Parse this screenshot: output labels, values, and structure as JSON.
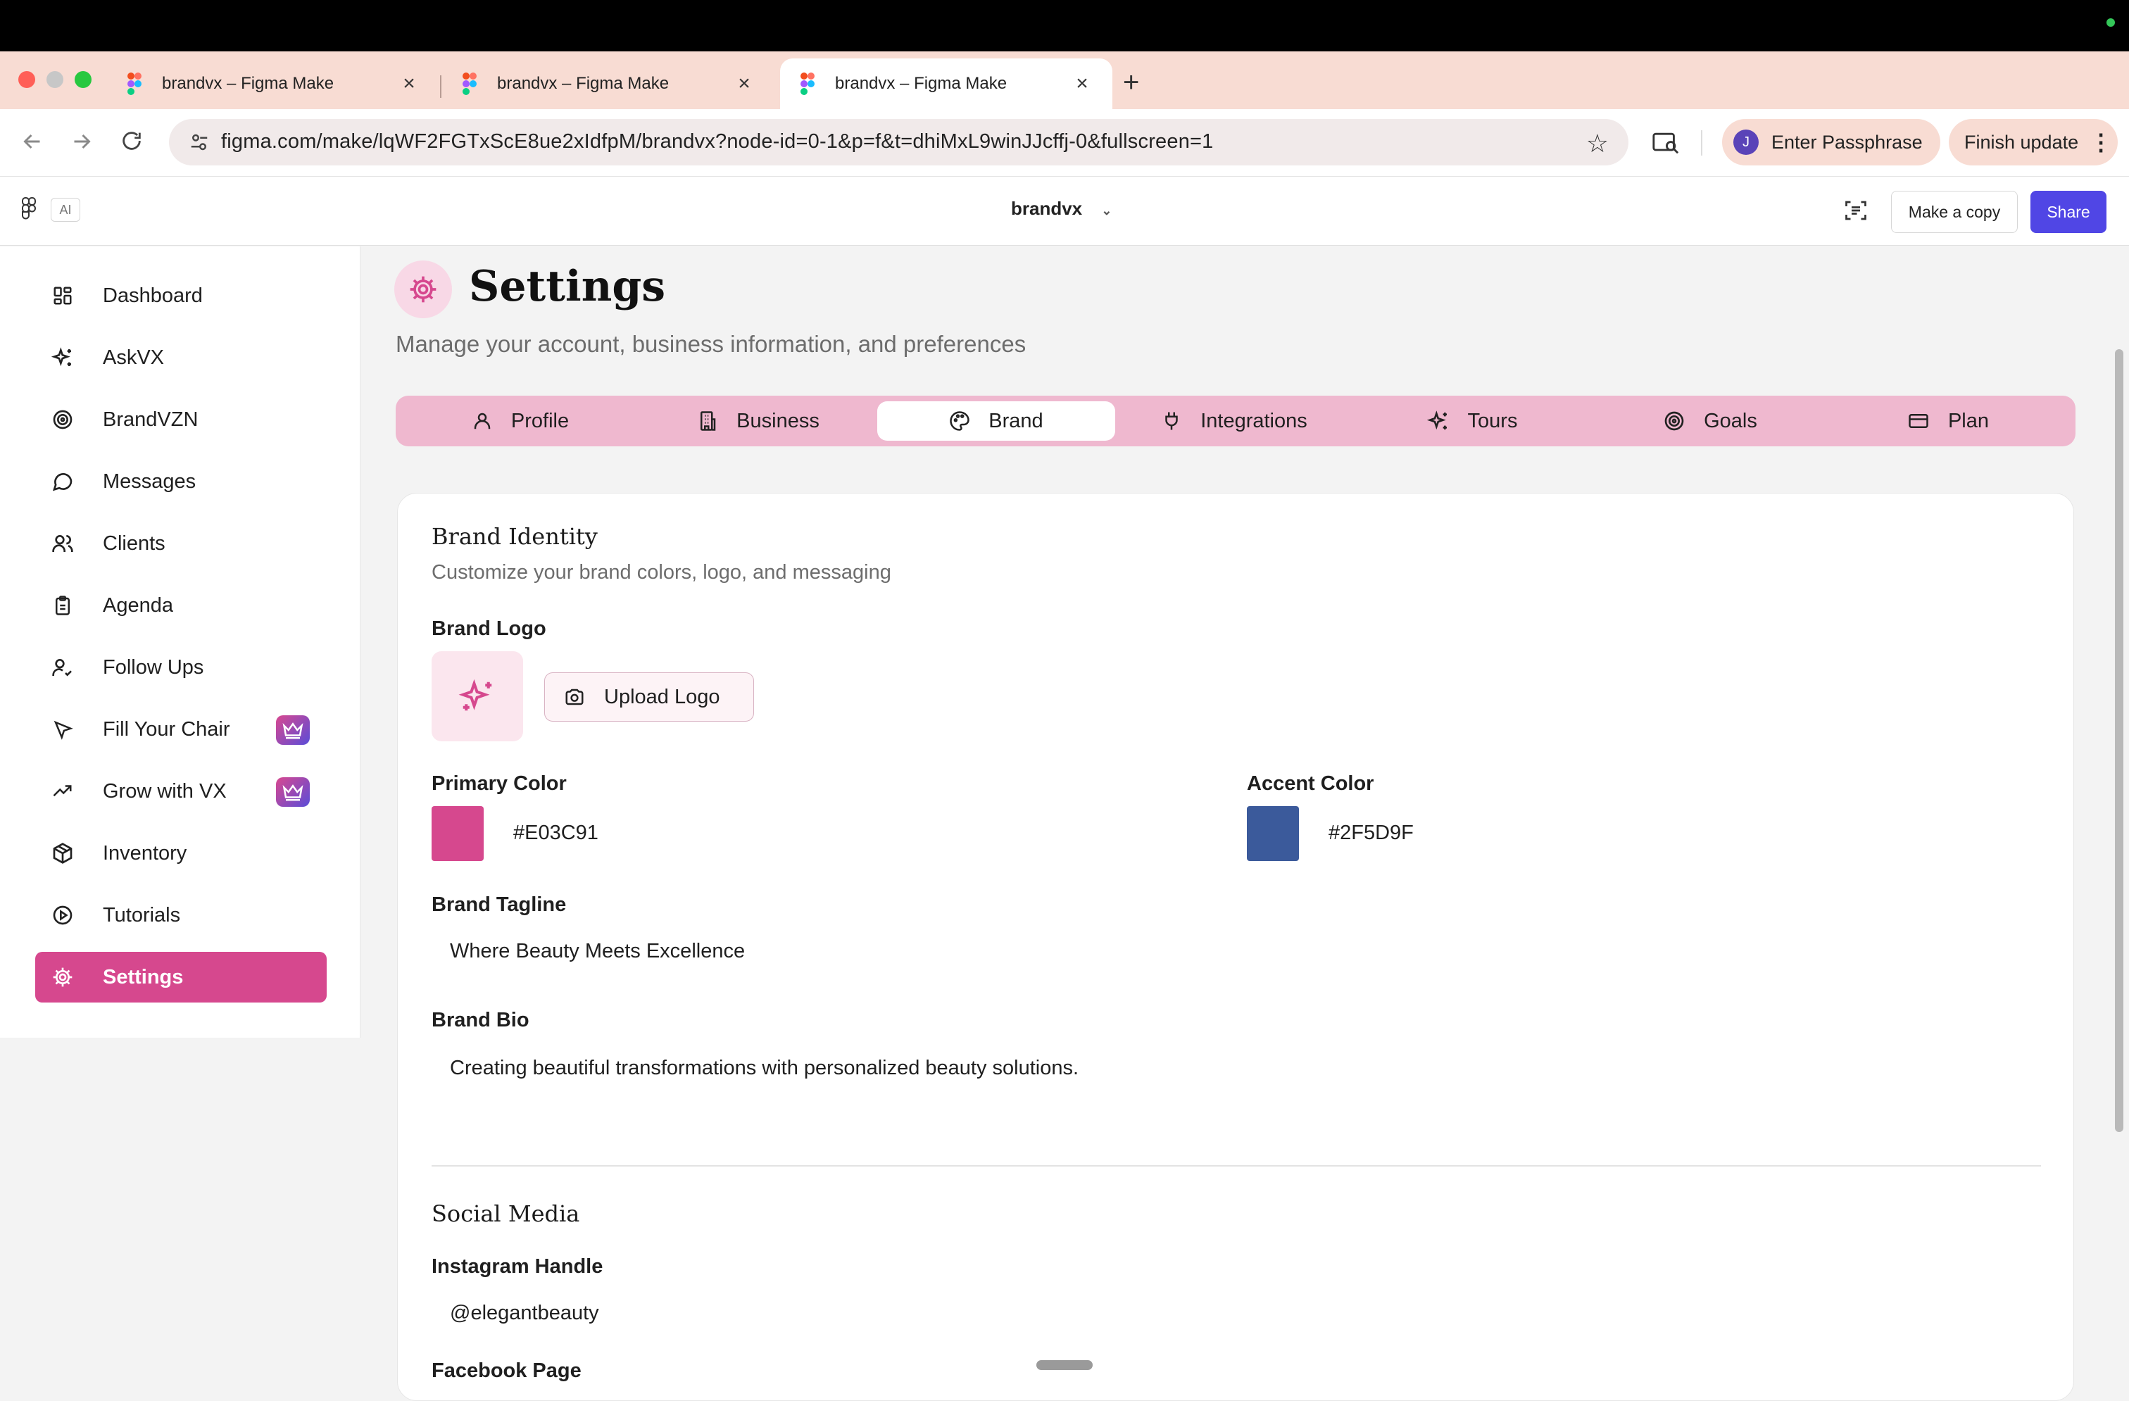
{
  "browser": {
    "tabs": [
      {
        "title": "brandvx – Figma Make",
        "active": false
      },
      {
        "title": "brandvx – Figma Make",
        "active": false
      },
      {
        "title": "brandvx – Figma Make",
        "active": true
      }
    ],
    "url": "figma.com/make/lqWF2FGTxScE8ue2xIdfpM/brandvx?node-id=0-1&p=f&t=dhiMxL9winJJcffj-0&fullscreen=1",
    "profile_initial": "J",
    "passphrase_label": "Enter Passphrase",
    "update_label": "Finish update"
  },
  "figma": {
    "ai_badge": "AI",
    "file_name": "brandvx",
    "copy_label": "Make a copy",
    "share_label": "Share"
  },
  "sidebar": {
    "items": [
      {
        "label": "Dashboard",
        "icon": "dashboard-icon"
      },
      {
        "label": "AskVX",
        "icon": "sparkles-icon"
      },
      {
        "label": "BrandVZN",
        "icon": "target-icon"
      },
      {
        "label": "Messages",
        "icon": "message-icon"
      },
      {
        "label": "Clients",
        "icon": "users-icon"
      },
      {
        "label": "Agenda",
        "icon": "clipboard-icon"
      },
      {
        "label": "Follow Ups",
        "icon": "user-check-icon"
      },
      {
        "label": "Fill Your Chair",
        "icon": "cursor-icon",
        "badge": "crown-icon"
      },
      {
        "label": "Grow with VX",
        "icon": "trending-up-icon",
        "badge": "crown-icon"
      },
      {
        "label": "Inventory",
        "icon": "package-icon"
      },
      {
        "label": "Tutorials",
        "icon": "play-circle-icon"
      },
      {
        "label": "Settings",
        "icon": "gear-icon",
        "active": true
      }
    ]
  },
  "page": {
    "title": "Settings",
    "subtitle": "Manage your account, business information, and preferences",
    "tabs": [
      {
        "label": "Profile",
        "icon": "user-icon"
      },
      {
        "label": "Business",
        "icon": "building-icon"
      },
      {
        "label": "Brand",
        "icon": "palette-icon",
        "active": true
      },
      {
        "label": "Integrations",
        "icon": "plug-icon"
      },
      {
        "label": "Tours",
        "icon": "sparkles-icon"
      },
      {
        "label": "Goals",
        "icon": "target-icon"
      },
      {
        "label": "Plan",
        "icon": "card-icon"
      }
    ]
  },
  "brand": {
    "section_title": "Brand Identity",
    "section_sub": "Customize your brand colors, logo, and messaging",
    "logo_label": "Brand Logo",
    "upload_label": "Upload Logo",
    "primary_label": "Primary Color",
    "primary_value": "#E03C91",
    "accent_label": "Accent Color",
    "accent_value": "#2F5D9F",
    "tagline_label": "Brand Tagline",
    "tagline_value": "Where Beauty Meets Excellence",
    "bio_label": "Brand Bio",
    "bio_value": "Creating beautiful transformations with personalized beauty solutions."
  },
  "social": {
    "section_title": "Social Media",
    "instagram_label": "Instagram Handle",
    "instagram_value": "@elegantbeauty",
    "facebook_label": "Facebook Page"
  },
  "colors": {
    "brand_pink": "#d6488e",
    "share_purple": "#5046e5",
    "tab_bar": "#efb8cf",
    "primary_swatch": "#d6488e",
    "accent_swatch": "#3b5a9b"
  }
}
